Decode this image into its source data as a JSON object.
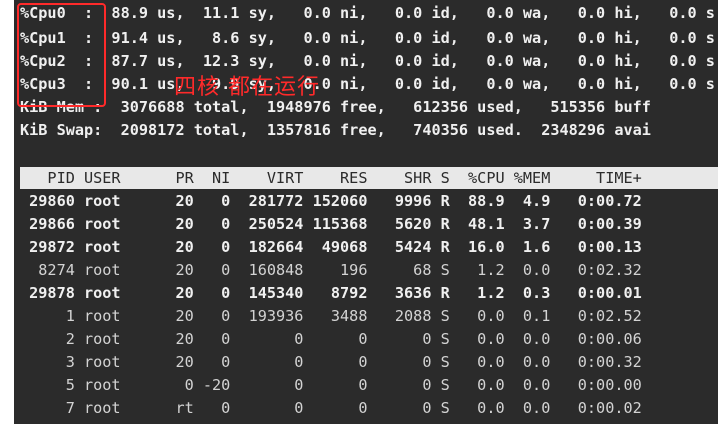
{
  "cpu_lines": [
    "%Cpu0  :  88.9 us,  11.1 sy,   0.0 ni,   0.0 id,   0.0 wa,   0.0 hi,   0.0 s",
    "%Cpu1  :  91.4 us,   8.6 sy,   0.0 ni,   0.0 id,   0.0 wa,   0.0 hi,   0.0 s",
    "%Cpu2  :  87.7 us,  12.3 sy,   0.0 ni,   0.0 id,   0.0 wa,   0.0 hi,   0.0 s",
    "%Cpu3  :  90.1 us,   9.9 sy,   0.0 ni,   0.0 id,   0.0 wa,   0.0 hi,   0.0 s"
  ],
  "mem_lines": [
    "KiB Mem :  3076688 total,  1948976 free,   612356 used,   515356 buff",
    "KiB Swap:  2098172 total,  1357816 free,   740356 used.  2348296 avai"
  ],
  "annotation": "四核 都在运行",
  "table": {
    "header": "   PID USER      PR  NI    VIRT    RES    SHR S  %CPU %MEM     TIME+",
    "rows": [
      " 29860 root      20   0  281772 152060   9996 R  88.9  4.9   0:00.72",
      " 29866 root      20   0  250524 115368   5620 R  48.1  3.7   0:00.39",
      " 29872 root      20   0  182664  49068   5424 R  16.0  1.6   0:00.13",
      "  8274 root      20   0  160848    196     68 S   1.2  0.0   0:02.32",
      " 29878 root      20   0  145340   8792   3636 R   1.2  0.3   0:00.01",
      "     1 root      20   0  193936   3488   2088 S   0.0  0.1   0:02.52",
      "     2 root      20   0       0      0      0 S   0.0  0.0   0:00.06",
      "     3 root      20   0       0      0      0 S   0.0  0.0   0:00.32",
      "     5 root       0 -20       0      0      0 S   0.0  0.0   0:00.00",
      "     7 root      rt   0       0      0      0 S   0.0  0.0   0:00.02"
    ]
  }
}
